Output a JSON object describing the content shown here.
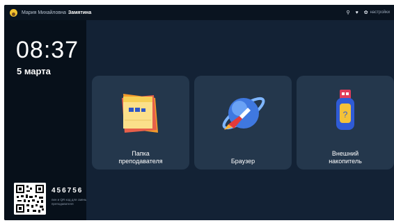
{
  "topbar": {
    "user_first": "Мария Михайловна",
    "user_last": "Замятина",
    "settings_label": "настройки"
  },
  "sidebar": {
    "time": "08:37",
    "date": "5 марта",
    "qr_code": "456756",
    "qr_hint": "пин и QR код для смены преподавателя"
  },
  "tiles": [
    {
      "label": "Папка\nпреподавателя",
      "icon": "folder-icon"
    },
    {
      "label": "Браузер",
      "icon": "browser-planet-icon"
    },
    {
      "label": "Внешний\nнакопитель",
      "icon": "usb-drive-icon"
    }
  ],
  "colors": {
    "background": "#0d1a2a",
    "sidebar": "#07101a",
    "tile": "#24374c",
    "avatar": "#f2c230"
  }
}
